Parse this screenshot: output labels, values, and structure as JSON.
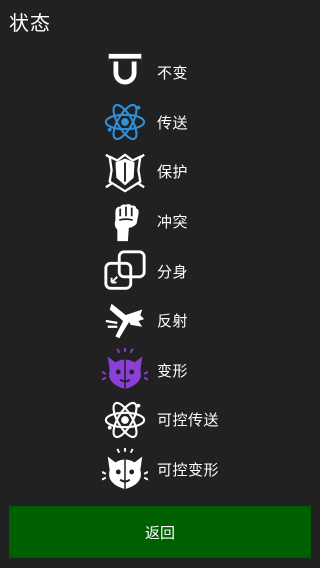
{
  "header": {
    "title": "状态"
  },
  "colors": {
    "background": "#212121",
    "button": "#006000",
    "teleport_blue": "#2f8fd8",
    "transform_purple": "#8a3fd6"
  },
  "statuses": [
    {
      "icon": "horseshoe-magnet-icon",
      "label": "不变"
    },
    {
      "icon": "atom-icon",
      "label": "传送"
    },
    {
      "icon": "shield-icon",
      "label": "保护"
    },
    {
      "icon": "raised-fist-icon",
      "label": "冲突"
    },
    {
      "icon": "duplicate-squares-icon",
      "label": "分身"
    },
    {
      "icon": "reflect-arrow-icon",
      "label": "反射"
    },
    {
      "icon": "cat-transform-icon",
      "label": "变形"
    },
    {
      "icon": "atom-outline-icon",
      "label": "可控传送"
    },
    {
      "icon": "cat-transform-outline-icon",
      "label": "可控变形"
    }
  ],
  "footer": {
    "back_label": "返回"
  }
}
